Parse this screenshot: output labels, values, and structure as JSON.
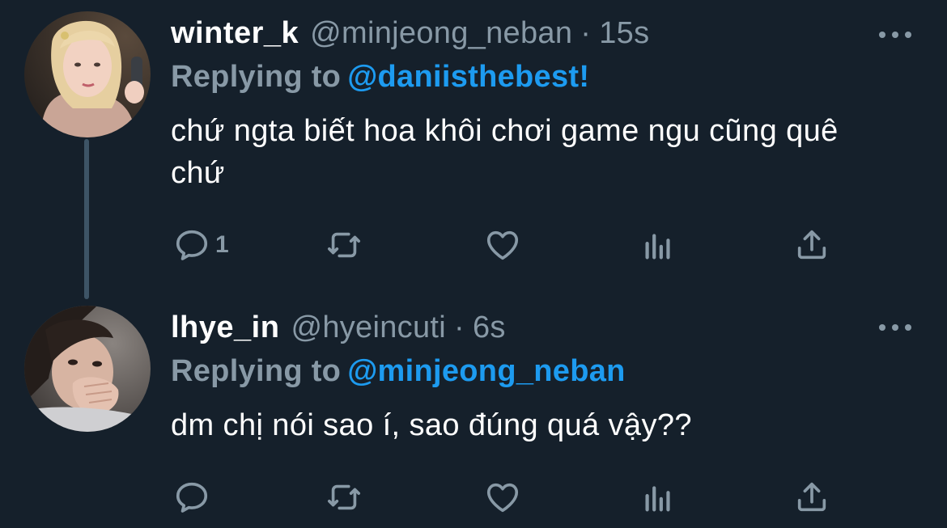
{
  "tweets": [
    {
      "display_name": "winter_k",
      "handle": "@minjeong_neban",
      "separator": "·",
      "time": "15s",
      "replying_label": "Replying to",
      "replying_to": "@daniisthebest!",
      "text": "chứ ngta biết hoa khôi chơi game ngu cũng quê chứ",
      "reply_count": "1",
      "icons": [
        "reply-icon",
        "retweet-icon",
        "like-icon",
        "analytics-icon",
        "share-icon",
        "more-icon"
      ]
    },
    {
      "display_name": "lhye_in",
      "handle": "@hyeincuti",
      "separator": "·",
      "time": "6s",
      "replying_label": "Replying to",
      "replying_to": "@minjeong_neban",
      "text": "dm chị nói sao í, sao đúng quá vậy??",
      "reply_count": "",
      "icons": [
        "reply-icon",
        "retweet-icon",
        "like-icon",
        "analytics-icon",
        "share-icon",
        "more-icon"
      ]
    }
  ],
  "colors": {
    "background": "#15202b",
    "text_primary": "#ffffff",
    "text_secondary": "#8899a6",
    "accent": "#1d9bf0",
    "thread_line": "#3d5466"
  }
}
